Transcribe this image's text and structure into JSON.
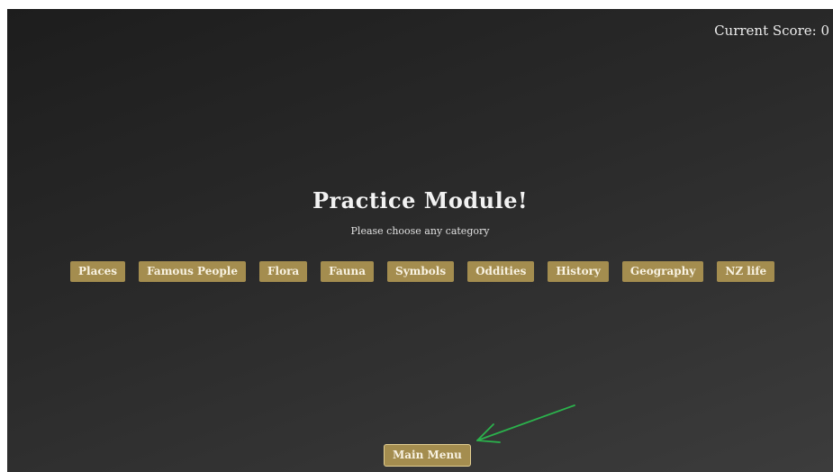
{
  "score": {
    "label": "Current Score: 0"
  },
  "header": {
    "title": "Practice Module!",
    "subtitle": "Please choose any category"
  },
  "categories": [
    {
      "label": "Places"
    },
    {
      "label": "Famous People"
    },
    {
      "label": "Flora"
    },
    {
      "label": "Fauna"
    },
    {
      "label": "Symbols"
    },
    {
      "label": "Oddities"
    },
    {
      "label": "History"
    },
    {
      "label": "Geography"
    },
    {
      "label": "NZ life"
    }
  ],
  "footer": {
    "main_menu_label": "Main Menu"
  },
  "colors": {
    "button_bg": "#a48d4f",
    "button_text": "#f8f2e2",
    "arrow": "#2bb24c"
  }
}
